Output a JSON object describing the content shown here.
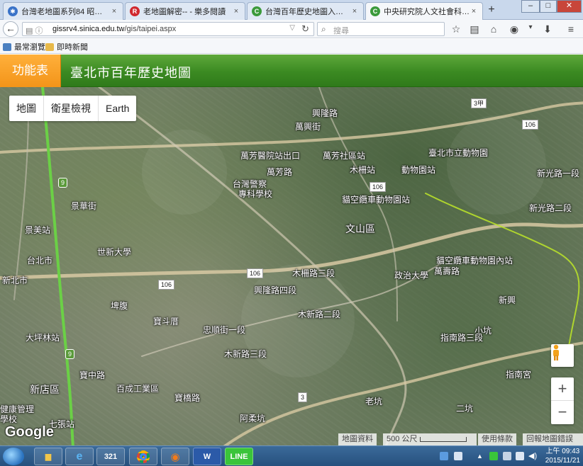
{
  "browser": {
    "tabs": [
      {
        "title": "台灣老地圖系列84 昭和15...",
        "icon": "blue-gear-icon",
        "color": "#3a73c8",
        "glyph": "✱"
      },
      {
        "title": "老地圖解密-- - 樂多閱讀",
        "icon": "red-r-icon",
        "color": "#d0282e",
        "glyph": "R"
      },
      {
        "title": "台灣百年歷史地圖入口網站",
        "icon": "green-c-icon",
        "color": "#3b9a3b",
        "glyph": "C"
      },
      {
        "title": "中央研究院人文社會科學...",
        "icon": "green-c-icon",
        "color": "#3b9a3b",
        "glyph": "C"
      }
    ],
    "new_tab": "+",
    "url_host": "gissrv4.sinica.edu.tw",
    "url_path": "/gis/taipei.aspx",
    "search_placeholder": "搜尋",
    "bookmarks": [
      "最常瀏覽",
      "即時新聞"
    ]
  },
  "app": {
    "menu_label": "功能表",
    "title": "臺北市百年歷史地圖",
    "header_color": "#3b8a22",
    "menu_color": "#f39419"
  },
  "map": {
    "map_types": [
      "地圖",
      "衛星檢視",
      "Earth"
    ],
    "zoom_in": "+",
    "zoom_out": "−",
    "logo": "Google",
    "footer": {
      "map_data": "地圖資料",
      "scale": "500 公尺",
      "terms": "使用條款",
      "report": "回報地圖錯誤"
    },
    "labels": [
      "景美站",
      "世新大學",
      "景華街",
      "台北市",
      "新北市",
      "大坪林站",
      "新店區",
      "七張站",
      "健康管理",
      "學校",
      "萬芳醫院站出口",
      "萬芳社區站",
      "台灣警察",
      "專科學校",
      "萬芳路",
      "木柵站",
      "動物園站",
      "臺北市立動物園",
      "貓空纜車動物園站",
      "文山區",
      "貓空纜車動物園內站",
      "政治大學",
      "萬壽路",
      "木柵路三段",
      "興隆路四段",
      "忠順街一段",
      "木新路三段",
      "寶斗厝",
      "埤腹",
      "新興",
      "小坑",
      "指南宮",
      "阿柔坑",
      "老坑",
      "百成工業區",
      "寶中路",
      "新光路一段",
      "興隆路",
      "萬興街",
      "指南路三段",
      "寶橋路",
      "二坑",
      "木新路二段",
      "新光路二段"
    ],
    "shields": [
      "106",
      "106",
      "106",
      "106",
      "9",
      "9",
      "3",
      "3甲"
    ]
  },
  "taskbar": {
    "apps": [
      "explorer-icon",
      "ie-icon",
      "calendar-icon",
      "chrome-icon",
      "firefox-icon",
      "word-icon",
      "line-icon"
    ],
    "time": "上午 09:43",
    "date": "2015/11/21"
  }
}
